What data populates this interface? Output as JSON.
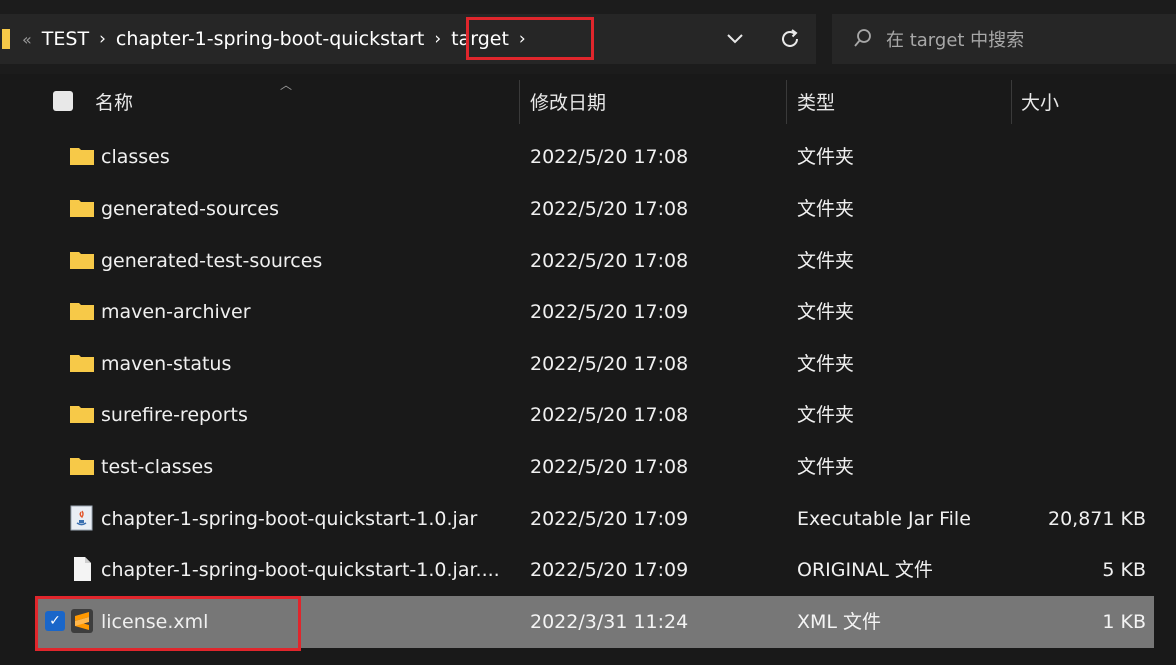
{
  "breadcrumb": {
    "overflow": "«",
    "items": [
      "TEST",
      "chapter-1-spring-boot-quickstart",
      "target"
    ],
    "separator": "›"
  },
  "search": {
    "placeholder": "在 target 中搜索"
  },
  "columns": {
    "name": "名称",
    "date": "修改日期",
    "type": "类型",
    "size": "大小"
  },
  "files": [
    {
      "name": "classes",
      "date": "2022/5/20 17:08",
      "type": "文件夹",
      "size": "",
      "icon": "folder-icon"
    },
    {
      "name": "generated-sources",
      "date": "2022/5/20 17:08",
      "type": "文件夹",
      "size": "",
      "icon": "folder-icon"
    },
    {
      "name": "generated-test-sources",
      "date": "2022/5/20 17:08",
      "type": "文件夹",
      "size": "",
      "icon": "folder-icon"
    },
    {
      "name": "maven-archiver",
      "date": "2022/5/20 17:09",
      "type": "文件夹",
      "size": "",
      "icon": "folder-icon"
    },
    {
      "name": "maven-status",
      "date": "2022/5/20 17:08",
      "type": "文件夹",
      "size": "",
      "icon": "folder-icon"
    },
    {
      "name": "surefire-reports",
      "date": "2022/5/20 17:08",
      "type": "文件夹",
      "size": "",
      "icon": "folder-icon"
    },
    {
      "name": "test-classes",
      "date": "2022/5/20 17:08",
      "type": "文件夹",
      "size": "",
      "icon": "folder-icon"
    },
    {
      "name": "chapter-1-spring-boot-quickstart-1.0.jar",
      "date": "2022/5/20 17:09",
      "type": "Executable Jar File",
      "size": "20,871 KB",
      "icon": "java-jar-icon"
    },
    {
      "name": "chapter-1-spring-boot-quickstart-1.0.jar....",
      "date": "2022/5/20 17:09",
      "type": "ORIGINAL 文件",
      "size": "5 KB",
      "icon": "file-icon"
    },
    {
      "name": "license.xml",
      "date": "2022/3/31 11:24",
      "type": "XML 文件",
      "size": "1 KB",
      "icon": "sublime-text-icon",
      "selected": true
    }
  ],
  "colors": {
    "background": "#191919",
    "selected_row": "#777777",
    "highlight_box": "#e0262c",
    "folder": "#f7c948",
    "checkbox_selected": "#1a66c9"
  }
}
